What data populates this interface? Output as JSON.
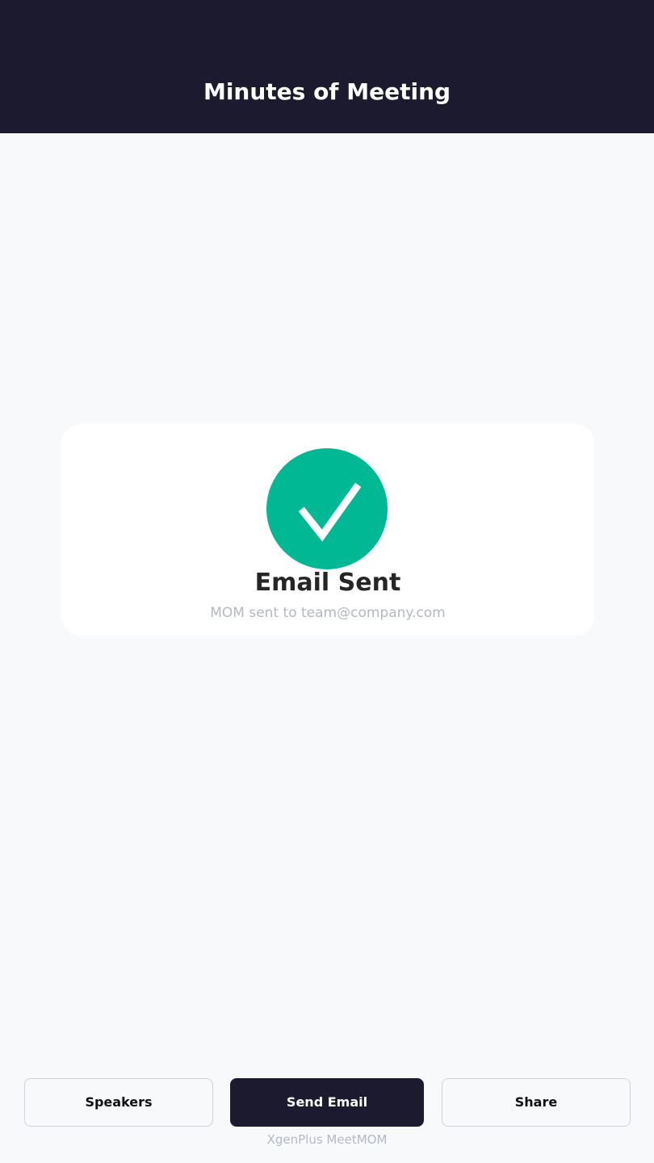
{
  "header": {
    "title": "Minutes of Meeting"
  },
  "status_card": {
    "icon": "check-circle-icon",
    "title": "Email Sent",
    "subtitle": "MOM sent to team@company.com",
    "icon_color": "#00b894"
  },
  "actions": {
    "speakers_label": "Speakers",
    "send_email_label": "Send Email",
    "share_label": "Share"
  },
  "footer": {
    "brand": "XgenPlus MeetMOM"
  },
  "colors": {
    "header_bg": "#1b1a2e",
    "page_bg": "#f8f9fb",
    "primary_button_bg": "#1b1a2e",
    "muted_text": "#b4b8c0"
  }
}
